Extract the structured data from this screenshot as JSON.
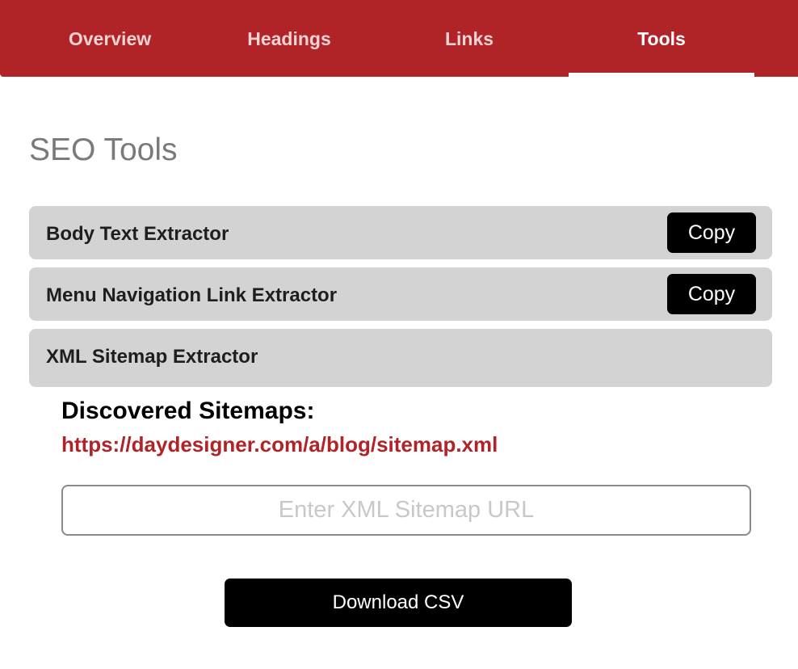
{
  "nav": {
    "tabs": [
      {
        "label": "Overview",
        "active": false
      },
      {
        "label": "Headings",
        "active": false
      },
      {
        "label": "Links",
        "active": false
      },
      {
        "label": "Tools",
        "active": true
      }
    ]
  },
  "main": {
    "title": "SEO Tools",
    "tools": [
      {
        "label": "Body Text Extractor",
        "button": "Copy"
      },
      {
        "label": "Menu Navigation Link Extractor",
        "button": "Copy"
      },
      {
        "label": "XML Sitemap Extractor"
      }
    ],
    "sitemaps": {
      "heading": "Discovered Sitemaps:",
      "links": [
        "https://daydesigner.com/a/blog/sitemap.xml"
      ]
    },
    "sitemap_input": {
      "value": "",
      "placeholder": "Enter XML Sitemap URL"
    },
    "download_label": "Download CSV"
  },
  "colors": {
    "brand": "#b02428",
    "row_bg": "#d3d3d3",
    "button_bg": "#000000"
  }
}
